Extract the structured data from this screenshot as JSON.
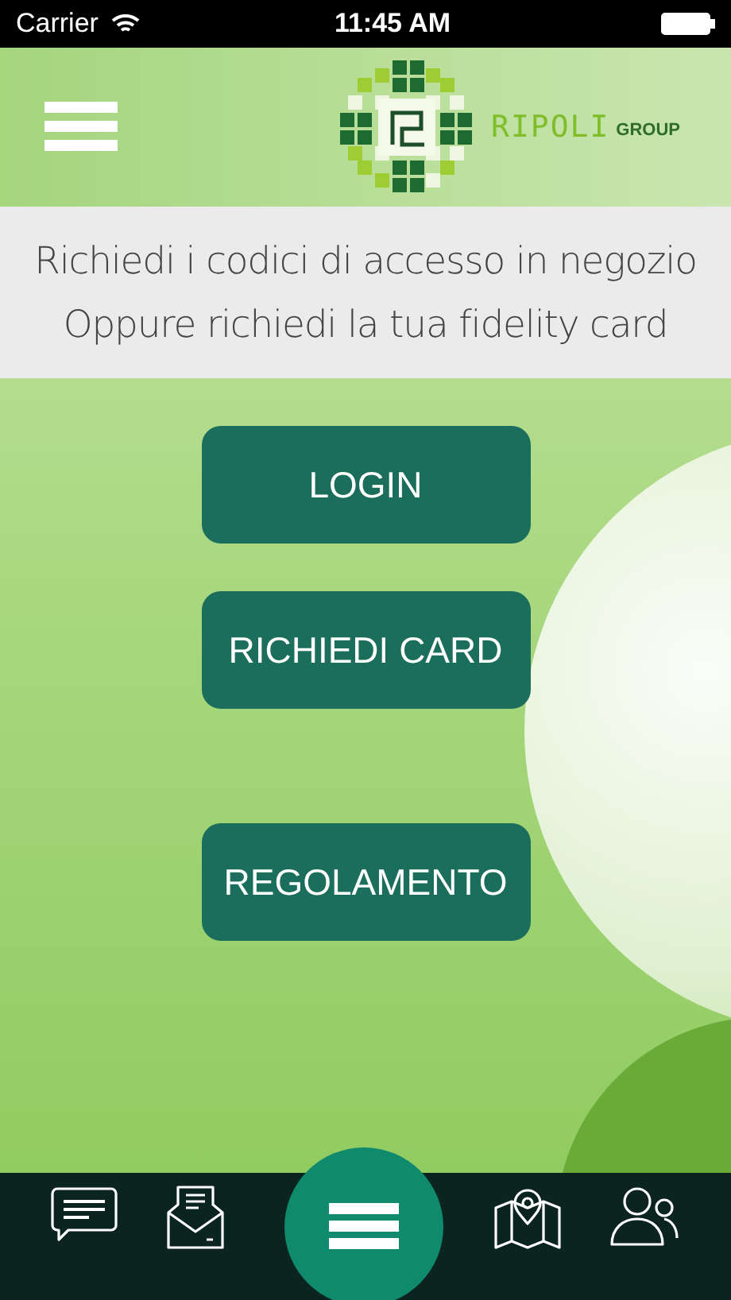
{
  "status_bar": {
    "carrier": "Carrier",
    "time": "11:45 AM"
  },
  "logo": {
    "name": "RIPOLI",
    "group": "GROUP"
  },
  "info_lines": [
    "Richiedi i codici di accesso in negozio",
    "Oppure richiedi la tua fidelity card"
  ],
  "buttons": [
    {
      "label": "LOGIN"
    },
    {
      "label": "RICHIEDI CARD"
    },
    {
      "label": "REGOLAMENTO"
    }
  ],
  "tab_bar": [
    {
      "kind": "chat"
    },
    {
      "kind": "mail"
    },
    {
      "kind": "menu"
    },
    {
      "kind": "map"
    },
    {
      "kind": "people"
    }
  ]
}
